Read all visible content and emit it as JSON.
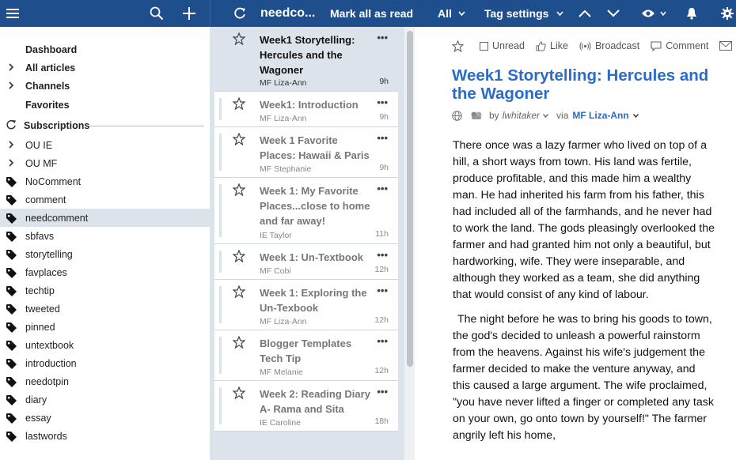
{
  "topbar": {
    "title": "needco...",
    "mark_all_read": "Mark all as read",
    "filter": "All",
    "tag_settings": "Tag settings"
  },
  "sidebar": {
    "dashboard": "Dashboard",
    "all_articles": "All articles",
    "channels": "Channels",
    "favorites": "Favorites",
    "subscriptions": "Subscriptions",
    "folders": [
      "OU IE",
      "OU MF"
    ],
    "tags": [
      "NoComment",
      "comment",
      "needcomment",
      "sbfavs",
      "storytelling",
      "favplaces",
      "techtip",
      "tweeted",
      "pinned",
      "untextbook",
      "introduction",
      "needotpin",
      "diary",
      "essay",
      "lastwords"
    ],
    "active_tag": "needcomment"
  },
  "articles": [
    {
      "title": "Week1 Storytelling: Hercules and the Wagoner",
      "source": "MF Liza-Ann",
      "time": "9h"
    },
    {
      "title": "Week1: Introduction",
      "source": "MF Liza-Ann",
      "time": "9h"
    },
    {
      "title": "Week 1 Favorite Places: Hawaii & Paris",
      "source": "MF Stephanie",
      "time": "9h"
    },
    {
      "title": "Week 1: My Favorite Places...close to home and far away!",
      "source": "IE Taylor",
      "time": "11h"
    },
    {
      "title": "Week 1: Un-Textbook",
      "source": "MF Cobi",
      "time": "12h"
    },
    {
      "title": "Week 1: Exploring the Un-Texbook",
      "source": "MF Liza-Ann",
      "time": "12h"
    },
    {
      "title": "Blogger Templates Tech Tip",
      "source": "MF Melanie",
      "time": "12h"
    },
    {
      "title": "Week 2: Reading Diary A- Rama and Sita",
      "source": "IE Caroline",
      "time": "18h"
    }
  ],
  "reader": {
    "actions": {
      "unread": "Unread",
      "like": "Like",
      "broadcast": "Broadcast",
      "comment": "Comment"
    },
    "title": "Week1 Storytelling: Hercules and the Wagoner",
    "by": "by",
    "author": "lwhitaker",
    "via": "via",
    "feed": "MF Liza-Ann",
    "paragraphs": [
      "There once was a lazy farmer who lived on top of a hill, a short ways from town.  His land was fertile, produce profitable, and this made him a wealthy man.  He had inherited his farm from his father, this had included all of the farmhands, and he never had to work the land. The gods pleasingly overlooked the farmer and had granted him not only a beautiful, but hardworking, wife.  They were inseparable, and although they worked as a team, she did anything that would consist of any kind of labour.",
      " The night before he was to bring his goods to town, the god's decided to unleash a powerful rainstorm from the heavens.  Against his wife's judgement the farmer decided to make the venture anyway, and this caused a large argument. The wife proclaimed, \"you have never lifted a finger or completed any task on your own, go onto town by yourself!\" The farmer angrily left his home,"
    ]
  },
  "colors": {
    "topbar": "#1f4e8c",
    "accent": "#2a6cc7",
    "list_bg": "#dde3ea"
  }
}
